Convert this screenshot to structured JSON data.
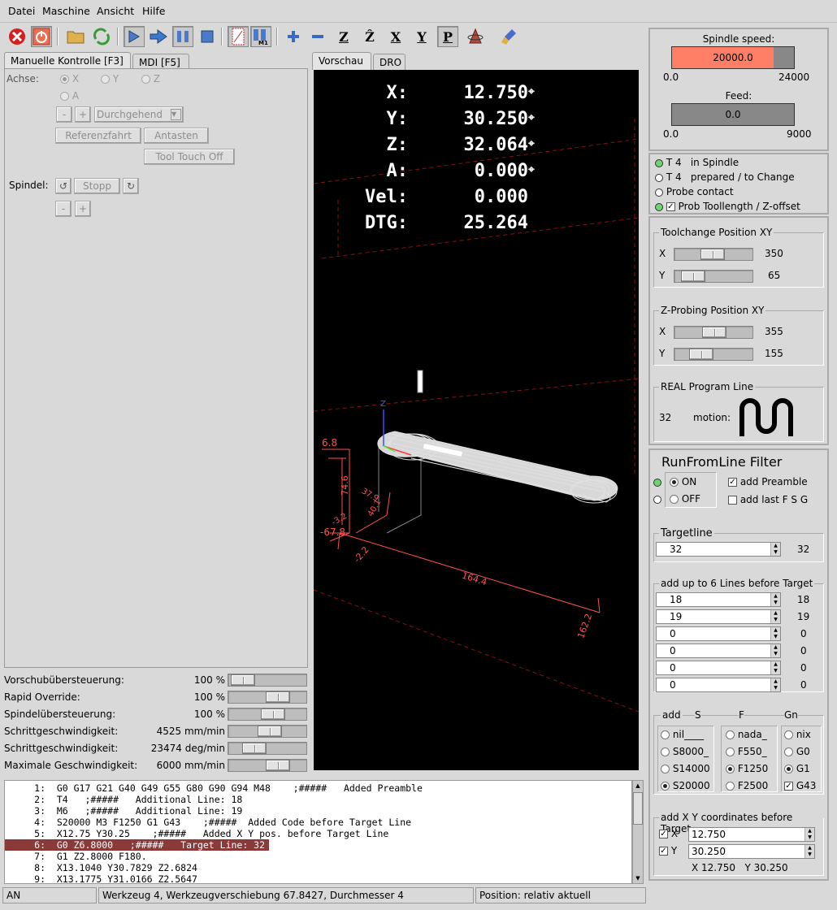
{
  "menu": [
    "Datei",
    "Maschine",
    "Ansicht",
    "Hilfe"
  ],
  "left_tabs": [
    "Manuelle Kontrolle [F3]",
    "MDI [F5]"
  ],
  "manual": {
    "achse_label": "Achse:",
    "axes": [
      "X",
      "Y",
      "Z",
      "A"
    ],
    "minus": "-",
    "plus": "+",
    "jog_mode": "Durchgehend",
    "home_btn": "Referenzfahrt",
    "touch_btn": "Antasten",
    "tool_touch_btn": "Tool Touch Off",
    "spindle_label": "Spindel:",
    "stop_btn": "Stopp"
  },
  "overrides": [
    {
      "label": "Vorschubübersteuerung:",
      "value": "100 %",
      "level": 0.05
    },
    {
      "label": "Rapid Override:",
      "value": "100 %",
      "level": 0.7
    },
    {
      "label": "Spindelübersteuerung:",
      "value": "100 %",
      "level": 0.6
    },
    {
      "label": "Schrittgeschwindigkeit:",
      "value": "4525 mm/min",
      "level": 0.55
    },
    {
      "label": "Schrittgeschwindigkeit:",
      "value": "23474 deg/min",
      "level": 0.25
    },
    {
      "label": "Maximale Geschwindigkeit:",
      "value": "6000 mm/min",
      "level": 0.7
    }
  ],
  "view_tabs": [
    "Vorschau",
    "DRO"
  ],
  "dro": [
    {
      "label": "X:",
      "value": "12.750"
    },
    {
      "label": "Y:",
      "value": "30.250"
    },
    {
      "label": "Z:",
      "value": "32.064"
    },
    {
      "label": "A:",
      "value": "0.000"
    },
    {
      "label": "Vel:",
      "value": "0.000"
    },
    {
      "label": "DTG:",
      "value": "25.264"
    }
  ],
  "preview_dims": {
    "z_top": "6.8",
    "z_h": "74.6",
    "w1": "37.9",
    "w2": "40.1",
    "n2": "-3.2",
    "z_bot": "-67.8",
    "x_neg": "-2.2",
    "len": "164.4",
    "depth": "162.2",
    "axis_z": "Z"
  },
  "code_lines": [
    {
      "n": "1:",
      "t": "G0 G17 G21 G40 G49 G55 G80 G90 G94 M48    ;#####   Added Preamble"
    },
    {
      "n": "2:",
      "t": "T4   ;#####   Additional Line: 18"
    },
    {
      "n": "3:",
      "t": "M6   ;#####   Additional Line: 19"
    },
    {
      "n": "4:",
      "t": "S20000 M3 F1250 G1 G43    ;#####  Added Code before Target Line"
    },
    {
      "n": "5:",
      "t": "X12.75 Y30.25    ;#####   Added X Y pos. before Target Line"
    },
    {
      "n": "6:",
      "t": "G0 Z6.8000   ;#####   Target Line: 32",
      "highlight": true
    },
    {
      "n": "7:",
      "t": "G1 Z2.8000 F180."
    },
    {
      "n": "8:",
      "t": "X13.1040 Y30.7829 Z2.6824"
    },
    {
      "n": "9:",
      "t": "X13.1775 Y31.0166 Z2.5647"
    }
  ],
  "status": {
    "mode": "AN",
    "tool": "Werkzeug 4, Werkzeugverschiebung 67.8427, Durchmesser 4",
    "position": "Position: relativ aktuell"
  },
  "spindle": {
    "label": "Spindle speed:",
    "value": "20000.0",
    "min": "0.0",
    "max": "24000",
    "fraction": 0.833,
    "color": "#ff7f66"
  },
  "feed": {
    "label": "Feed:",
    "value": "0.0",
    "min": "0.0",
    "max": "9000"
  },
  "tool_status": [
    {
      "led": "green",
      "code": "T 4",
      "text": "in Spindle"
    },
    {
      "led": "off",
      "code": "T 4",
      "text": "prepared / to Change"
    },
    {
      "led": "off",
      "code": "",
      "text": "Probe contact"
    },
    {
      "led": "green",
      "code": "",
      "text": "Prob Toollength / Z-offset",
      "checked": true
    }
  ],
  "toolchange": {
    "title": "Toolchange Position XY",
    "x_label": "X",
    "x": "350",
    "y_label": "Y",
    "y": "65"
  },
  "zprobe": {
    "title": "Z-Probing Position XY",
    "x_label": "X",
    "x": "355",
    "y_label": "Y",
    "y": "155"
  },
  "real_line": {
    "title": "REAL Program Line",
    "line": "32",
    "motion_label": "motion:"
  },
  "runfromline": {
    "title": "RunFromLine Filter",
    "on": "ON",
    "off": "OFF",
    "add_preamble": "add Preamble",
    "add_last": "add last F S G",
    "target_title": "Targetline",
    "target": "32",
    "target_display": "32",
    "lines_title": "add up to 6 Lines before Target",
    "lines": [
      {
        "v": "18",
        "d": "18"
      },
      {
        "v": "19",
        "d": "19"
      },
      {
        "v": "0",
        "d": "0"
      },
      {
        "v": "0",
        "d": "0"
      },
      {
        "v": "0",
        "d": "0"
      },
      {
        "v": "0",
        "d": "0"
      }
    ],
    "add_label": "add",
    "s_label": "S",
    "f_label": "F",
    "g_label": "Gn",
    "s_opts": [
      "nil____",
      "S8000_",
      "S14000",
      "S20000"
    ],
    "f_opts": [
      "nada_",
      "F550_",
      "F1250",
      "F2500"
    ],
    "g_opts": [
      "nix",
      "G0",
      "G1",
      "G43"
    ],
    "xy_title": "add X Y coordinates before Target",
    "x_label": "X",
    "x": "12.750",
    "y_label": "Y",
    "y": "30.250",
    "xy_display": "X 12.750   Y 30.250"
  }
}
